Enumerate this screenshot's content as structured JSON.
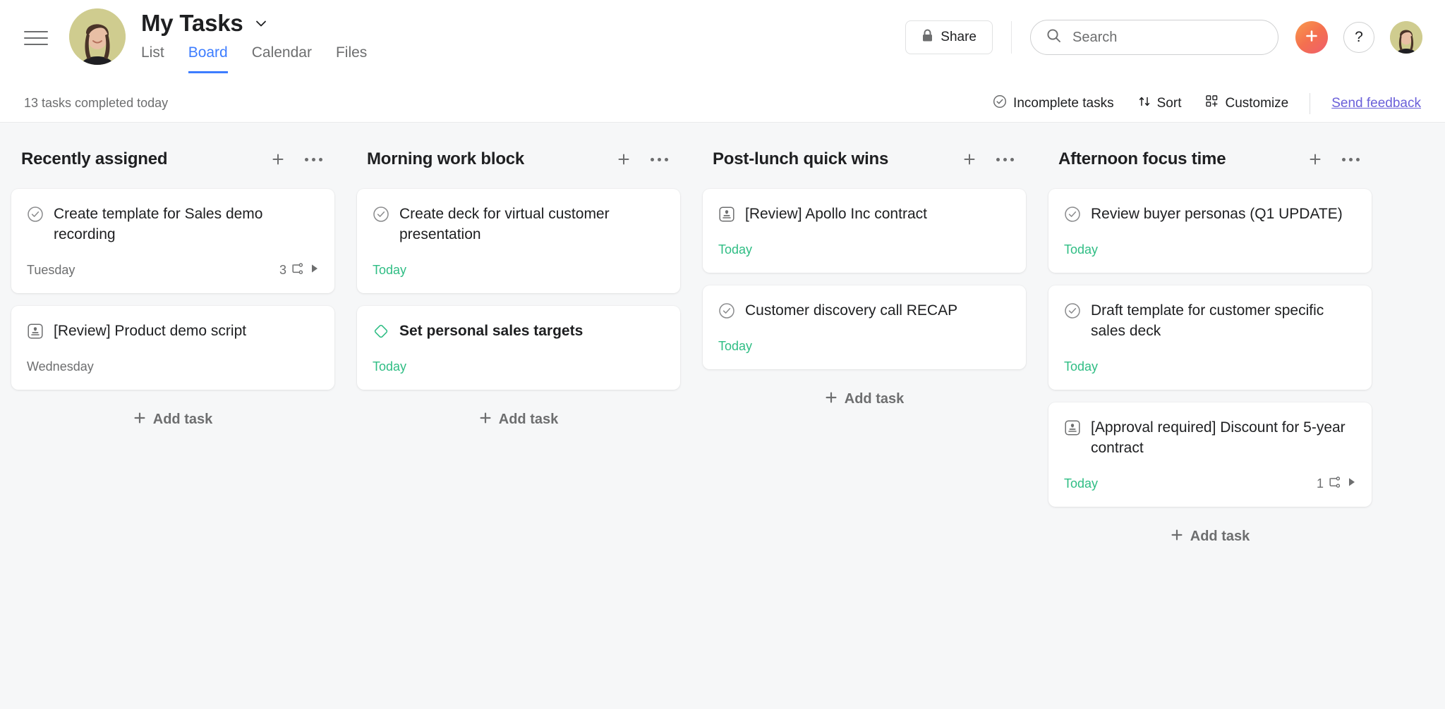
{
  "header": {
    "project_title": "My Tasks",
    "tabs": [
      {
        "label": "List",
        "active": false
      },
      {
        "label": "Board",
        "active": true
      },
      {
        "label": "Calendar",
        "active": false
      },
      {
        "label": "Files",
        "active": false
      }
    ],
    "share_label": "Share",
    "search_placeholder": "Search",
    "help_label": "?",
    "accent_color": "#3d7dff",
    "create_button_color": "#f4704f"
  },
  "toolbar": {
    "tasks_completed": "13 tasks completed today",
    "incomplete_tasks": "Incomplete tasks",
    "sort": "Sort",
    "customize": "Customize",
    "send_feedback": "Send feedback",
    "feedback_color": "#6a5fd9"
  },
  "board": {
    "add_task_label": "Add task",
    "columns": [
      {
        "title": "Recently assigned",
        "cards": [
          {
            "title": "Create template for Sales demo recording",
            "icon": "check-circle-icon",
            "bold": false,
            "due": "Tuesday",
            "due_state": "plain",
            "subtask_count": "3"
          },
          {
            "title": "[Review] Product demo script",
            "icon": "approval-stamp-icon",
            "bold": false,
            "due": "Wednesday",
            "due_state": "plain",
            "subtask_count": ""
          }
        ]
      },
      {
        "title": "Morning work block",
        "cards": [
          {
            "title": "Create deck for virtual customer presentation",
            "icon": "check-circle-icon",
            "bold": false,
            "due": "Today",
            "due_state": "today",
            "subtask_count": ""
          },
          {
            "title": "Set personal sales targets",
            "icon": "milestone-diamond-icon",
            "bold": true,
            "due": "Today",
            "due_state": "today",
            "subtask_count": ""
          }
        ]
      },
      {
        "title": "Post-lunch quick wins",
        "cards": [
          {
            "title": "[Review] Apollo Inc contract",
            "icon": "approval-stamp-icon",
            "bold": false,
            "due": "Today",
            "due_state": "today",
            "subtask_count": ""
          },
          {
            "title": "Customer discovery call RECAP",
            "icon": "check-circle-icon",
            "bold": false,
            "due": "Today",
            "due_state": "today",
            "subtask_count": ""
          }
        ]
      },
      {
        "title": "Afternoon focus time",
        "cards": [
          {
            "title": "Review buyer personas (Q1 UPDATE)",
            "icon": "check-circle-icon",
            "bold": false,
            "due": "Today",
            "due_state": "today",
            "subtask_count": ""
          },
          {
            "title": "Draft template for customer specific sales deck",
            "icon": "check-circle-icon",
            "bold": false,
            "due": "Today",
            "due_state": "today",
            "subtask_count": ""
          },
          {
            "title": "[Approval required] Discount for 5-year contract",
            "icon": "approval-stamp-icon",
            "bold": false,
            "due": "Today",
            "due_state": "today",
            "subtask_count": "1"
          }
        ]
      }
    ]
  }
}
